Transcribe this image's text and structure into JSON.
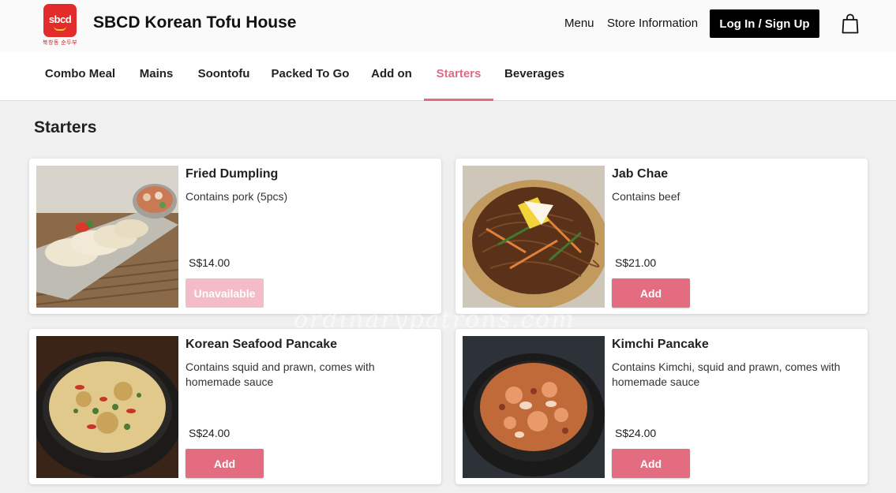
{
  "header": {
    "logo_text": "sbcd",
    "logo_subtext": "북창동 순두부",
    "brand": "SBCD Korean Tofu House",
    "links": [
      "Menu",
      "Store Information"
    ],
    "login_label": "Log In / Sign Up",
    "cart_icon": "shopping-bag-icon"
  },
  "categories": [
    {
      "label": "Combo Meal",
      "active": false
    },
    {
      "label": "Mains",
      "active": false
    },
    {
      "label": "Soontofu",
      "active": false
    },
    {
      "label": "Packed To Go",
      "active": false
    },
    {
      "label": "Add on",
      "active": false
    },
    {
      "label": "Starters",
      "active": true
    },
    {
      "label": "Beverages",
      "active": false
    }
  ],
  "section_title": "Starters",
  "items": [
    {
      "name": "Fried Dumpling",
      "description": "Contains pork (5pcs)",
      "price": "S$14.00",
      "button": "Unavailable",
      "available": false
    },
    {
      "name": "Jab Chae",
      "description": "Contains beef",
      "price": "S$21.00",
      "button": "Add",
      "available": true
    },
    {
      "name": "Korean Seafood Pancake",
      "description": "Contains squid and prawn, comes with homemade sauce",
      "price": "S$24.00",
      "button": "Add",
      "available": true
    },
    {
      "name": "Kimchi Pancake",
      "description": "Contains Kimchi, squid and prawn, comes with homemade sauce",
      "price": "S$24.00",
      "button": "Add",
      "available": true
    }
  ],
  "watermark": "ordinarypatrons.com",
  "colors": {
    "accent": "#e46c81",
    "accent_disabled": "#f3bcc7",
    "logo_red": "#e32b2b"
  }
}
